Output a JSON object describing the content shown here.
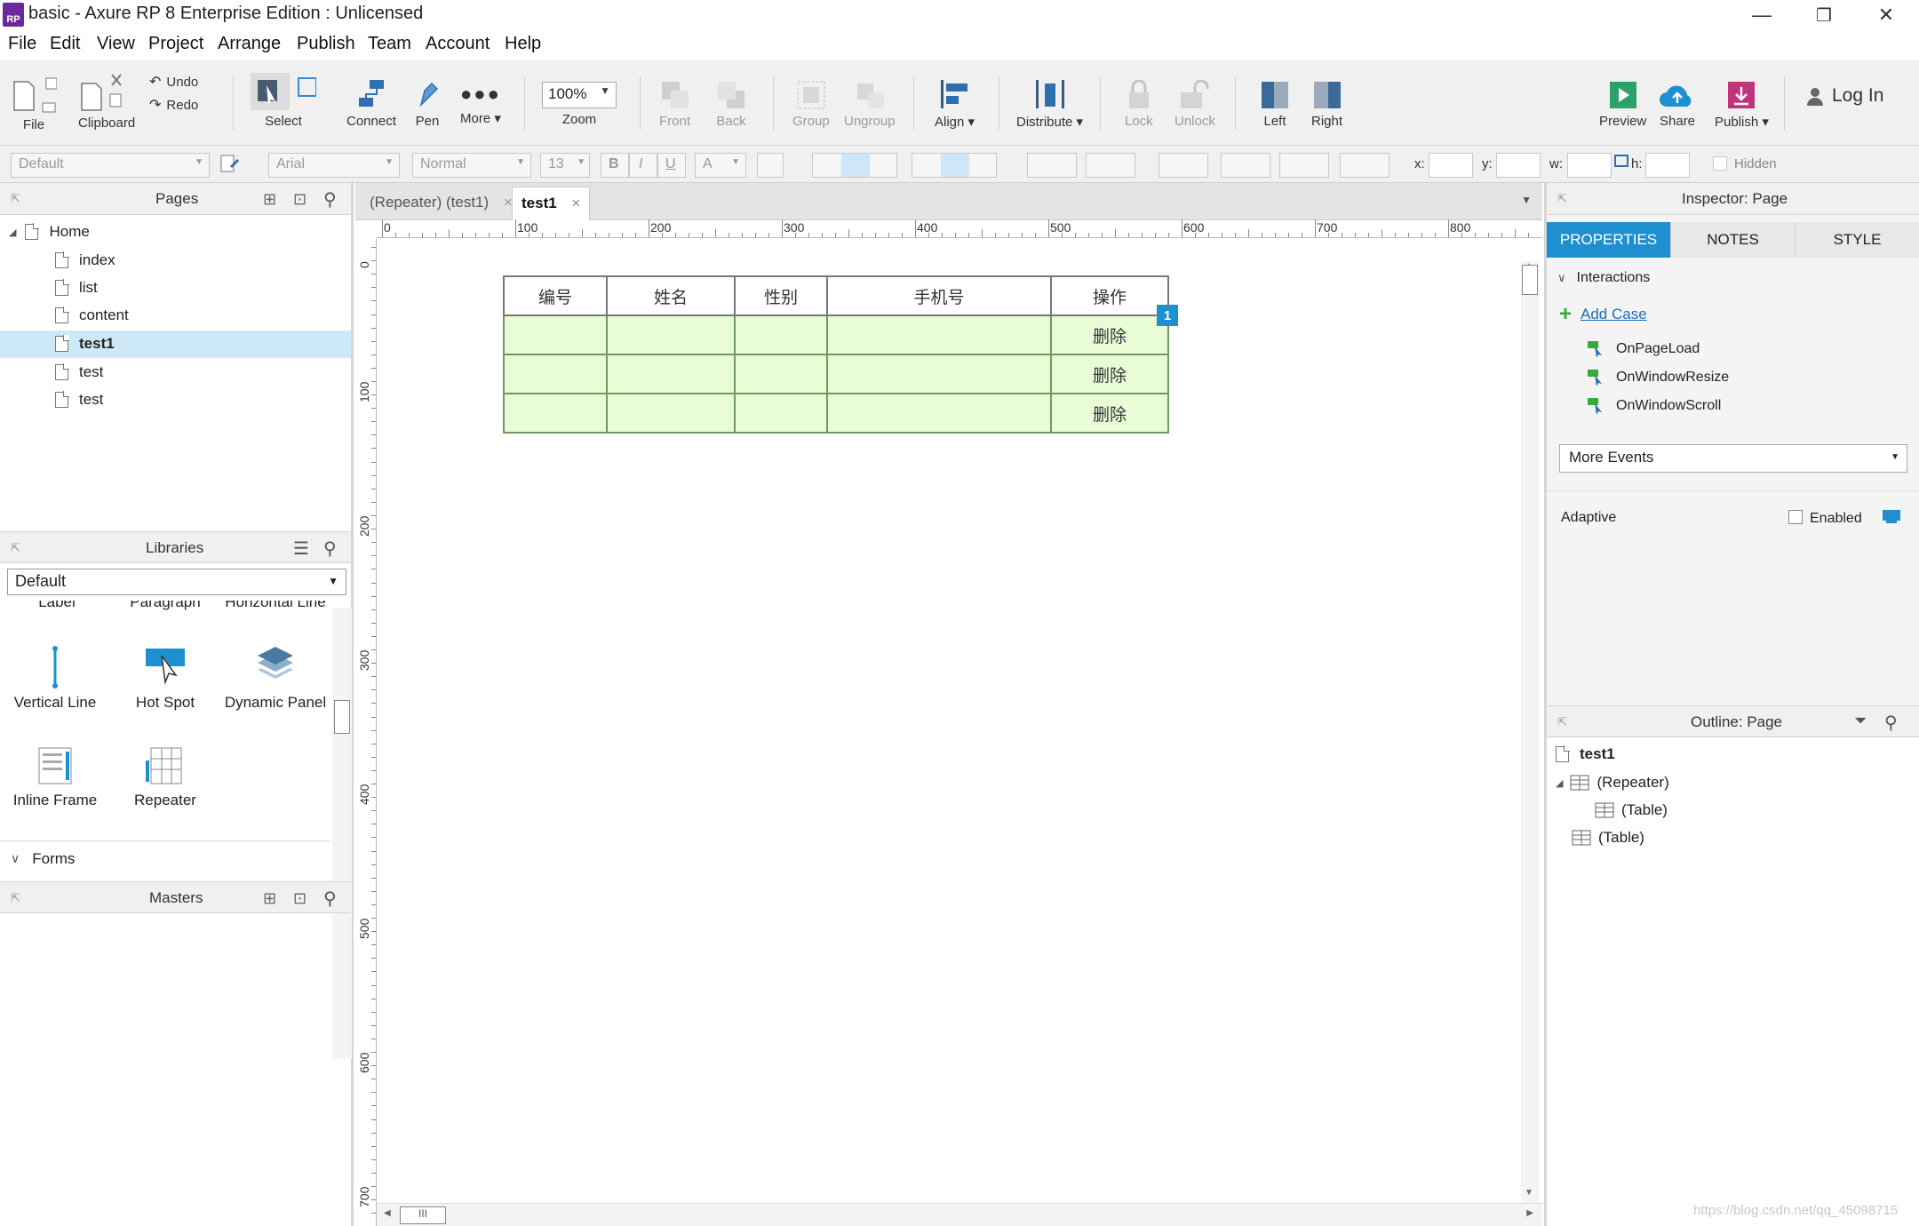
{
  "window": {
    "title": "basic - Axure RP 8 Enterprise Edition : Unlicensed",
    "logo_text": "RP",
    "controls": {
      "minimize": "—",
      "restore": "❐",
      "close": "✕"
    }
  },
  "menubar": {
    "items": [
      "File",
      "Edit",
      "View",
      "Project",
      "Arrange",
      "Publish",
      "Team",
      "Account",
      "Help"
    ]
  },
  "toolbar": {
    "file": "File",
    "clipboard": "Clipboard",
    "undo": "Undo",
    "redo": "Redo",
    "select": "Select",
    "connect": "Connect",
    "pen": "Pen",
    "more": "More ▾",
    "zoom_value": "100%",
    "zoom": "Zoom",
    "front": "Front",
    "back": "Back",
    "group": "Group",
    "ungroup": "Ungroup",
    "align": "Align ▾",
    "distribute": "Distribute ▾",
    "lock": "Lock",
    "unlock": "Unlock",
    "left": "Left",
    "right": "Right",
    "preview": "Preview",
    "share": "Share",
    "publish": "Publish ▾",
    "login": "Log In"
  },
  "format_bar": {
    "style": "Default",
    "font": "Arial",
    "weight": "Normal",
    "size": "13",
    "bold": "B",
    "italic": "I",
    "underline": "U",
    "font_color": "A",
    "x_label": "x:",
    "y_label": "y:",
    "w_label": "w:",
    "h_label": "h:",
    "hidden_label": "Hidden"
  },
  "pages_panel": {
    "title": "Pages",
    "root": "Home",
    "pages": [
      "index",
      "list",
      "content",
      "test1",
      "test",
      "test"
    ],
    "selected": "test1"
  },
  "libraries_panel": {
    "title": "Libraries",
    "selected_library": "Default",
    "partial_labels": [
      "Label",
      "Paragraph",
      "Horizontal Line"
    ],
    "items": [
      "Vertical Line",
      "Hot Spot",
      "Dynamic Panel",
      "Inline Frame",
      "Repeater"
    ],
    "section": "Forms"
  },
  "masters_panel": {
    "title": "Masters"
  },
  "canvas": {
    "tabs": [
      {
        "label": "(Repeater) (test1)",
        "active": false
      },
      {
        "label": "test1",
        "active": true
      }
    ],
    "ruler_h": [
      "0",
      "100",
      "200",
      "300",
      "400",
      "500",
      "600",
      "700",
      "800"
    ],
    "ruler_v": [
      "0",
      "100",
      "200",
      "300",
      "400",
      "500",
      "600",
      "700"
    ],
    "table": {
      "headers": [
        "编号",
        "姓名",
        "性别",
        "手机号",
        "操作"
      ],
      "rows": [
        [
          "",
          "",
          "",
          "",
          "删除"
        ],
        [
          "",
          "",
          "",
          "",
          "删除"
        ],
        [
          "",
          "",
          "",
          "",
          "删除"
        ]
      ],
      "row_color": "#e8fcd6"
    },
    "badge": "1",
    "hscroll_grip": "III"
  },
  "inspector": {
    "title": "Inspector: Page",
    "tabs": [
      "PROPERTIES",
      "NOTES",
      "STYLE"
    ],
    "active_tab": "PROPERTIES",
    "accent": "#1e90d0",
    "interactions_label": "Interactions",
    "add_case": "Add Case",
    "events": [
      "OnPageLoad",
      "OnWindowResize",
      "OnWindowScroll"
    ],
    "more_events": "More Events",
    "adaptive_label": "Adaptive",
    "enabled_label": "Enabled"
  },
  "outline": {
    "title": "Outline: Page",
    "page": "test1",
    "items": [
      "(Repeater)",
      "(Table)",
      "(Table)"
    ]
  },
  "watermark": "https://blog.csdn.net/qq_45098715"
}
